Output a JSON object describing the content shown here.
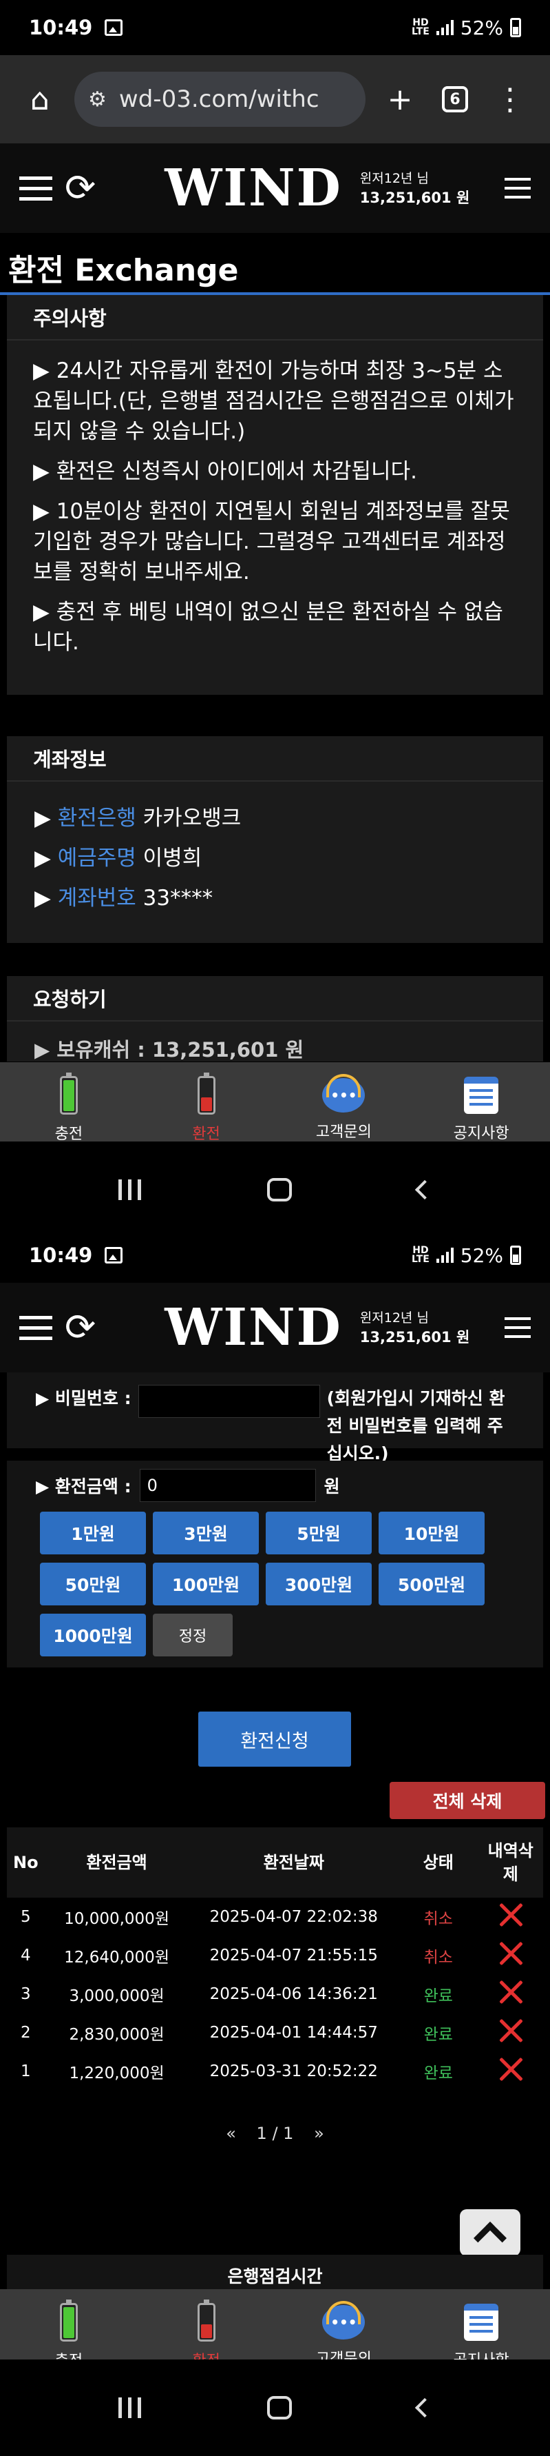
{
  "status": {
    "time": "10:49",
    "net_top": "HD",
    "net_bottom": "LTE",
    "battery": "52%"
  },
  "browser": {
    "url": "wd-03.com/withc",
    "tab_count": "6"
  },
  "header": {
    "logo": "WIND",
    "user_greeting": "윈저12년 님",
    "balance": "13,251,601 원"
  },
  "page": {
    "title": "환전 Exchange"
  },
  "notice": {
    "heading": "주의사항",
    "items": [
      "▶ 24시간 자유롭게 환전이 가능하며 최장 3~5분 소요됩니다.(단, 은행별 점검시간은 은행점검으로 이체가 되지 않을 수 있습니다.)",
      "▶ 환전은 신청즉시 아이디에서 차감됩니다.",
      "▶ 10분이상 환전이 지연될시 회원님 계좌정보를 잘못 기입한 경우가 많습니다. 그럴경우 고객센터로 계좌정보를 정확히 보내주세요.",
      "▶ 충전 후 베팅 내역이 없으신 분은 환전하실 수 없습니다."
    ]
  },
  "account": {
    "heading": "계좌정보",
    "bank_label": "환전은행",
    "bank_value": "카카오뱅크",
    "holder_label": "예금주명",
    "holder_value": "이병희",
    "number_label": "계좌번호",
    "number_value": "33****"
  },
  "request": {
    "heading": "요청하기",
    "balance_label": "▶ 보유캐쉬 : 13,251,601 원"
  },
  "tabbar": {
    "items": [
      "충전",
      "환전",
      "고객문의",
      "공지사항"
    ],
    "chat_dots": "•••"
  },
  "form": {
    "password_label": "▶ 비밀번호 :",
    "password_hint": "(회원가입시 기재하신 환전 비밀번호를 입력해 주십시오.)",
    "amount_label": "▶ 환전금액 :",
    "amount_value": "0",
    "amount_unit": "원",
    "amount_buttons": [
      "1만원",
      "3만원",
      "5만원",
      "10만원",
      "50만원",
      "100만원",
      "300만원",
      "500만원",
      "1000만원"
    ],
    "reset_label": "정정",
    "submit_label": "환전신청",
    "delete_all_label": "전체 삭제"
  },
  "history": {
    "headers": [
      "No",
      "환전금액",
      "환전날짜",
      "상태",
      "내역삭제"
    ],
    "rows": [
      {
        "no": "5",
        "amount": "10,000,000원",
        "date": "2025-04-07 22:02:38",
        "status": "취소"
      },
      {
        "no": "4",
        "amount": "12,640,000원",
        "date": "2025-04-07 21:55:15",
        "status": "취소"
      },
      {
        "no": "3",
        "amount": "3,000,000원",
        "date": "2025-04-06 14:36:21",
        "status": "완료"
      },
      {
        "no": "2",
        "amount": "2,830,000원",
        "date": "2025-04-01 14:44:57",
        "status": "완료"
      },
      {
        "no": "1",
        "amount": "1,220,000원",
        "date": "2025-03-31 20:52:22",
        "status": "완료"
      }
    ]
  },
  "pager": {
    "prev": "«",
    "current": "1 / 1",
    "next": "»"
  },
  "maintenance": {
    "title": "은행점검시간"
  },
  "colors": {
    "accent": "#2d6fc2",
    "cancel": "#e04444",
    "done": "#3fbf5a",
    "danger": "#b53232"
  }
}
